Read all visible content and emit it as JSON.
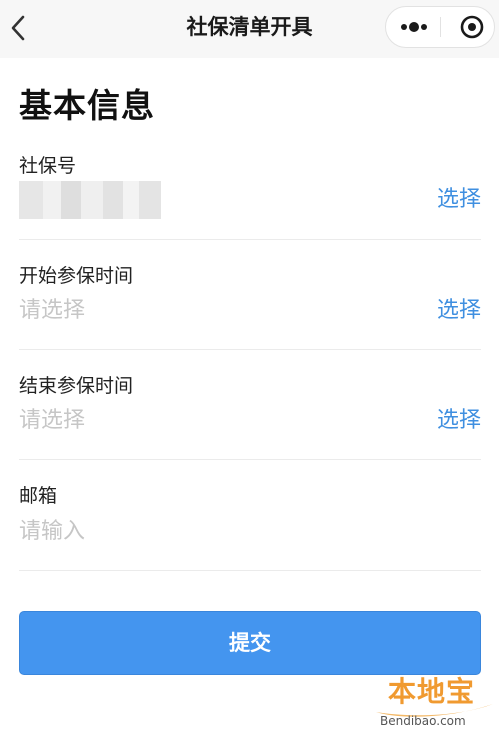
{
  "nav": {
    "title": "社保清单开具"
  },
  "section_title": "基本信息",
  "fields": [
    {
      "label": "社保号",
      "value": "",
      "action": "选择"
    },
    {
      "label": "开始参保时间",
      "value": "请选择",
      "action": "选择"
    },
    {
      "label": "结束参保时间",
      "value": "请选择",
      "action": "选择"
    },
    {
      "label": "邮箱",
      "value": "请输入"
    }
  ],
  "submit_label": "提交",
  "watermark": {
    "text": "本地宝",
    "url": "Bendibao.com"
  },
  "colors": {
    "accent": "#3f8fe0",
    "button": "#4495ef",
    "placeholder": "#c6c6c6",
    "watermark": "#f09a30"
  }
}
